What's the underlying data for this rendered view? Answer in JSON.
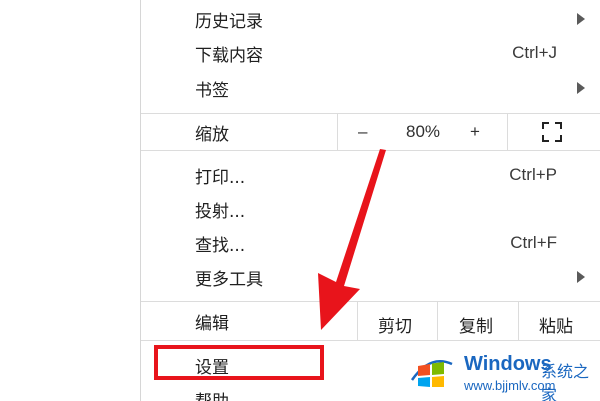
{
  "menu": {
    "history_label": "历史记录",
    "downloads_label": "下载内容",
    "downloads_shortcut": "Ctrl+J",
    "bookmarks_label": "书签",
    "zoom": {
      "label": "缩放",
      "minus": "–",
      "level": "80%",
      "plus": "+"
    },
    "print_label": "打印...",
    "print_shortcut": "Ctrl+P",
    "cast_label": "投射...",
    "find_label": "查找...",
    "find_shortcut": "Ctrl+F",
    "more_tools_label": "更多工具",
    "edit": {
      "label": "编辑",
      "cut": "剪切",
      "copy": "复制",
      "paste": "粘贴"
    },
    "settings_label": "设置",
    "help_label": "帮助"
  },
  "annotation": {
    "color": "#e8141b"
  },
  "watermark": {
    "title": "Windows",
    "subtitle": "系统之家",
    "url": "www.bjjmlv.com",
    "color": "#1a67c0"
  }
}
